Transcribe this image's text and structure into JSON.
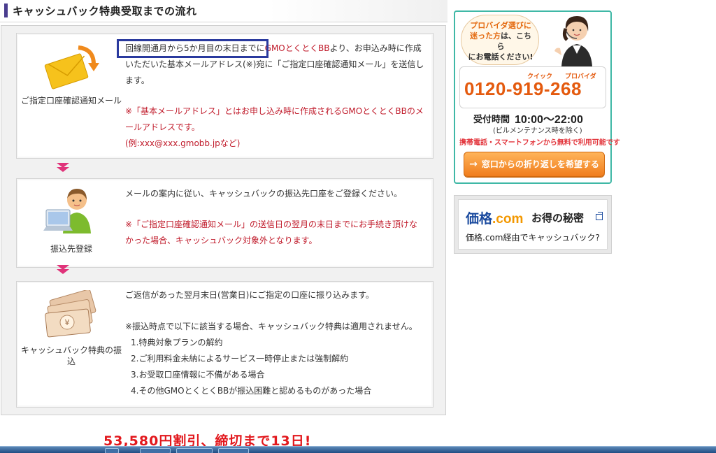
{
  "section": {
    "title": "キャッシュバック特典受取までの流れ"
  },
  "steps": [
    {
      "label": "ご指定口座確認通知メール",
      "icon": "envelope-icon",
      "text_highlight": "回線開通月から5か月目の末日までに",
      "text_brand": "GMOとくとくBB",
      "text_rest": "より、お申込み時に作成いただいた基本メールアドレス(※)宛に「ご指定口座確認通知メール」を送信します。",
      "note_1": "※「基本メールアドレス」とはお申し込み時に作成されるGMOとくとくBBのメールアドレスです。",
      "note_2": "(例:xxx@xxx.gmobb.jpなど)"
    },
    {
      "label": "振込先登録",
      "icon": "person-computer-icon",
      "text": "メールの案内に従い、キャッシュバックの振込先口座をご登録ください。",
      "note": "※「ご指定口座確認通知メール」の送信日の翌月の末日までにお手続き頂けなかった場合、キャッシュバック対象外となります。"
    },
    {
      "label": "キャッシュバック特典の振込",
      "icon": "money-icon",
      "text": "ご返信があった翌月末日(営業日)にご指定の口座に振り込みます。",
      "note": "※振込時点で以下に該当する場合、キャッシュバック特典は適用されません。",
      "items": [
        "1.特典対象プランの解約",
        "2.ご利用料金未納によるサービス一時停止または強制解約",
        "3.お受取口座情報に不備がある場合",
        "4.その他GMOとくとくBBが振込困難と認めるものがあった場合"
      ]
    }
  ],
  "sidebar": {
    "bubble_line1": "プロバイダ選びに",
    "bubble_line2a": "迷った方",
    "bubble_line2b": "は、こちら",
    "bubble_line3": "にお電話ください!",
    "ruby_quick": "クイック",
    "ruby_provider": "プロバイダ",
    "phone": "0120-919-268",
    "hours_label": "受付時間",
    "hours_value": "10:00〜22:00",
    "hours_note": "(ビルメンテナンス時を除く)",
    "free_note": "携帯電話・スマートフォンから無料で利用可能です",
    "callback_button": "窓口からの折り返しを希望する",
    "kakaku_logo_a": "価格",
    "kakaku_logo_b": ".com",
    "kakaku_secret": "お得の秘密",
    "kakaku_sub": "価格.com経由でキャッシュバック?"
  },
  "promo": {
    "text": "53,580円割引、締切まで13日!"
  },
  "colors": {
    "accent_purple": "#4a3d8f",
    "note_red": "#c01a2a",
    "arrow_pink": "#e0337a",
    "highlight_blue": "#2a3a9e",
    "phone_orange": "#e45a0e",
    "frame_teal": "#3fb8a6"
  }
}
